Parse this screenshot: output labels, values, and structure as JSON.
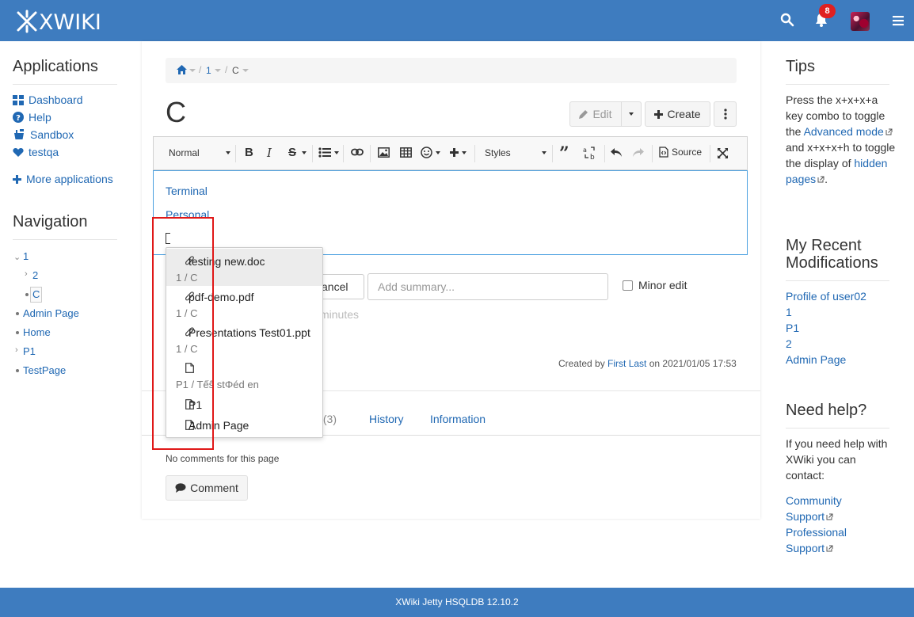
{
  "header": {
    "logo": "XWIKI",
    "notification_count": "8",
    "colors": {
      "bar": "#3e7cbf",
      "badge": "#e02020"
    }
  },
  "left_sidebar": {
    "applications_title": "Applications",
    "applications": [
      {
        "label": "Dashboard",
        "icon": "dashboard-icon"
      },
      {
        "label": "Help",
        "icon": "question-circle-icon"
      },
      {
        "label": "Sandbox",
        "icon": "sandbox-icon"
      },
      {
        "label": "testqa",
        "icon": "heart-icon"
      }
    ],
    "more_applications": "More applications",
    "navigation_title": "Navigation",
    "tree": [
      {
        "label": "1"
      },
      {
        "label": "2"
      },
      {
        "label": "C"
      },
      {
        "label": "Admin Page"
      },
      {
        "label": "Home"
      },
      {
        "label": "P1"
      },
      {
        "label": "TestPage"
      }
    ]
  },
  "breadcrumb": {
    "items": [
      "1",
      "C"
    ],
    "separator": "/"
  },
  "page": {
    "title": "C"
  },
  "page_actions": {
    "edit": "Edit",
    "create": "Create"
  },
  "editor": {
    "format": "Normal",
    "styles": "Styles",
    "source": "Source",
    "content_links": [
      "Terminal",
      "Personal"
    ]
  },
  "autocomplete": {
    "items": [
      {
        "title": "testing new.doc",
        "path": "1 / C",
        "icon": "paperclip-icon",
        "active": true
      },
      {
        "title": "pdf-demo.pdf",
        "path": "1 / C",
        "icon": "paperclip-icon"
      },
      {
        "title": "Presentations Test01.ppt",
        "path": "1 / C",
        "icon": "paperclip-icon"
      },
      {
        "title": "",
        "path": "P1 / Tếŝ stΦéd en",
        "icon": "page-icon"
      },
      {
        "title": "P1",
        "icon": "page-icon"
      },
      {
        "title": "Admin Page",
        "icon": "page-icon"
      }
    ]
  },
  "edit_form": {
    "cancel_fragment": "ancel",
    "summary_placeholder": "Add summary...",
    "minor_edit": "Minor edit",
    "autosave_fragment": "minutes"
  },
  "meta": {
    "created_prefix": "Created by",
    "author": "First Last",
    "created_on": "on 2021/01/05 17:53"
  },
  "tabs": [
    {
      "label": "s (3)"
    },
    {
      "label": "History"
    },
    {
      "label": "Information"
    }
  ],
  "comments": {
    "empty_text": "No comments for this page",
    "button": "Comment"
  },
  "right_sidebar": {
    "tips_title": "Tips",
    "tips": {
      "t1": "Press the x+x+x+a key combo to toggle the ",
      "link1": "Advanced mode",
      "t2": " and x+x+x+h to toggle the display of ",
      "link2": "hidden pages",
      "t3": "."
    },
    "recent_title": "My Recent Modifications",
    "recent": [
      "Profile of user02",
      "1",
      "P1",
      "2",
      "Admin Page"
    ],
    "help_title": "Need help?",
    "help_text": "If you need help with XWiki you can contact:",
    "help_links": [
      {
        "line1": "Community",
        "line2": "Support"
      },
      {
        "line1": "Professional",
        "line2": "Support"
      }
    ]
  },
  "footer": {
    "text": "XWiki Jetty HSQLDB 12.10.2"
  }
}
